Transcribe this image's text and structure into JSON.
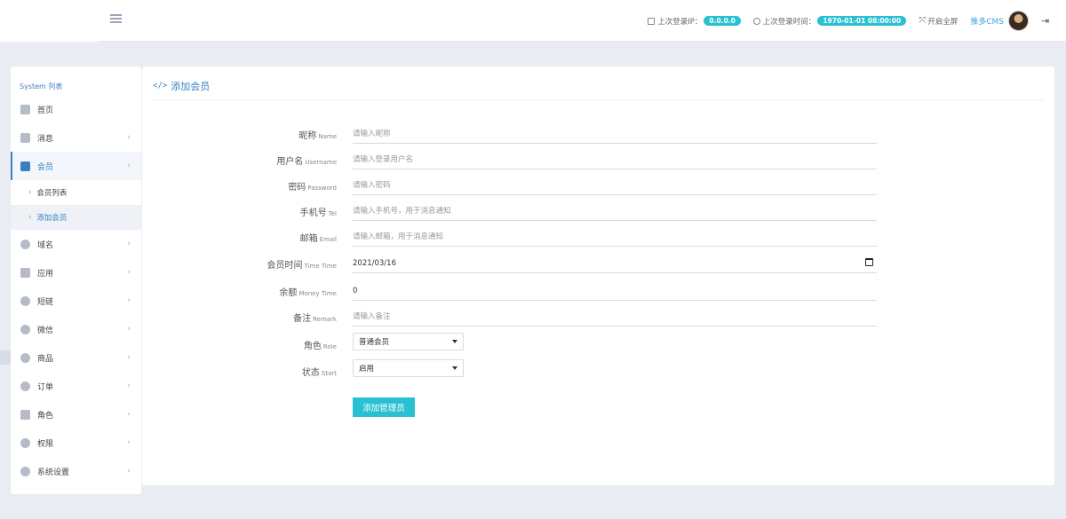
{
  "header": {
    "last_login_ip_label": "上次登录IP：",
    "last_login_ip": "0.0.0.0",
    "last_login_time_label": "上次登录时间：",
    "last_login_time": "1970-01-01 08:00:00",
    "fullscreen_label": "开启全屏",
    "username": "推多CMS"
  },
  "sidebar": {
    "title": "System 列表",
    "items": [
      {
        "label": "首页"
      },
      {
        "label": "消息"
      },
      {
        "label": "会员"
      },
      {
        "label": "域名"
      },
      {
        "label": "应用"
      },
      {
        "label": "短链"
      },
      {
        "label": "微信"
      },
      {
        "label": "商品"
      },
      {
        "label": "订单"
      },
      {
        "label": "角色"
      },
      {
        "label": "权限"
      },
      {
        "label": "系统设置"
      }
    ],
    "sub_items": [
      {
        "label": "会员列表"
      },
      {
        "label": "添加会员"
      }
    ]
  },
  "panel": {
    "title": "添加会员"
  },
  "form": {
    "nickname": {
      "label": "昵称",
      "en": "Name",
      "placeholder": "请输入昵称",
      "value": ""
    },
    "username": {
      "label": "用户名",
      "en": "Username",
      "placeholder": "请输入登录用户名",
      "value": ""
    },
    "password": {
      "label": "密码",
      "en": "Password",
      "placeholder": "请输入密码",
      "value": ""
    },
    "phone": {
      "label": "手机号",
      "en": "Tel",
      "placeholder": "请输入手机号，用于消息通知",
      "value": ""
    },
    "email": {
      "label": "邮箱",
      "en": "Email",
      "placeholder": "请输入邮箱，用于消息通知",
      "value": ""
    },
    "member_time": {
      "label": "会员时间",
      "en": "Time Time",
      "value": "2021/03/16"
    },
    "balance": {
      "label": "余额",
      "en": "Money Time",
      "value": "0"
    },
    "remark": {
      "label": "备注",
      "en": "Remark",
      "placeholder": "请输入备注",
      "value": ""
    },
    "role": {
      "label": "角色",
      "en": "Role",
      "selected": "普通会员"
    },
    "status": {
      "label": "状态",
      "en": "Start",
      "selected": "启用"
    },
    "submit_label": "添加管理员"
  },
  "colors": {
    "accent": "#29c0d3",
    "link": "#3a7fc1",
    "background": "#e9ecf3"
  }
}
